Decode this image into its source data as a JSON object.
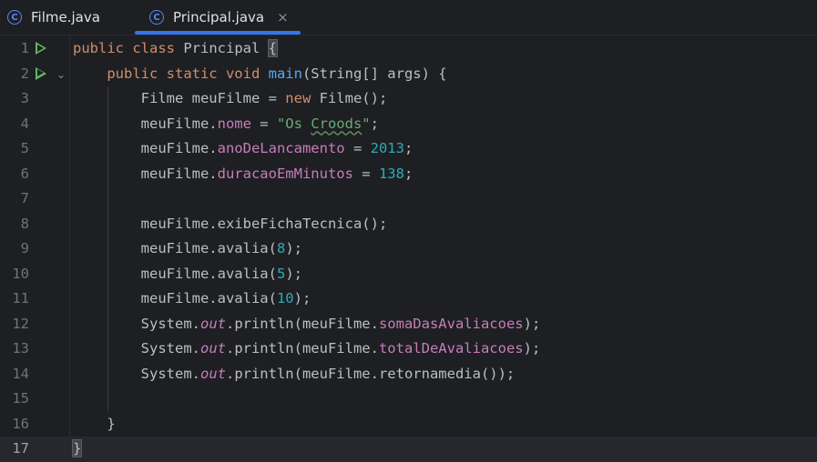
{
  "tabs": [
    {
      "icon": "C",
      "label": "Filme.java",
      "active": false
    },
    {
      "icon": "C",
      "label": "Principal.java",
      "active": true,
      "close": "×"
    }
  ],
  "colors": {
    "background": "#1e1f22",
    "keyword": "#cf8e6d",
    "method": "#56a8f5",
    "field": "#c77dbb",
    "number": "#2aacb8",
    "string": "#6aab73",
    "text": "#bcbec4",
    "active_tab_accent": "#3574f0",
    "run_icon": "#5fb865"
  },
  "gutter": {
    "run_icons": [
      "run-icon",
      "run-icon"
    ],
    "fold_icon": "chevron-down-icon"
  },
  "lines": [
    {
      "n": "1",
      "tokens": [
        [
          "kw",
          "public class "
        ],
        [
          "",
          "Principal "
        ],
        [
          "brace",
          "{"
        ]
      ]
    },
    {
      "n": "2",
      "tokens": [
        [
          "",
          "    "
        ],
        [
          "kw",
          "public static void "
        ],
        [
          "fn",
          "main"
        ],
        [
          "",
          "(String[] args) {"
        ]
      ]
    },
    {
      "n": "3",
      "tokens": [
        [
          "",
          "        Filme meuFilme = "
        ],
        [
          "kw",
          "new "
        ],
        [
          "",
          "Filme();"
        ]
      ]
    },
    {
      "n": "4",
      "tokens": [
        [
          "",
          "        meuFilme."
        ],
        [
          "fld",
          "nome"
        ],
        [
          "",
          " = "
        ],
        [
          "str",
          "\"Os "
        ],
        [
          "strtypo",
          "Croods"
        ],
        [
          "str",
          "\""
        ],
        [
          "",
          ";"
        ]
      ]
    },
    {
      "n": "5",
      "tokens": [
        [
          "",
          "        meuFilme."
        ],
        [
          "fld",
          "anoDeLancamento"
        ],
        [
          "",
          " = "
        ],
        [
          "num",
          "2013"
        ],
        [
          "",
          ";"
        ]
      ]
    },
    {
      "n": "6",
      "tokens": [
        [
          "",
          "        meuFilme."
        ],
        [
          "fld",
          "duracaoEmMinutos"
        ],
        [
          "",
          " = "
        ],
        [
          "num",
          "138"
        ],
        [
          "",
          ";"
        ]
      ]
    },
    {
      "n": "7",
      "tokens": []
    },
    {
      "n": "8",
      "tokens": [
        [
          "",
          "        meuFilme.exibeFichaTecnica();"
        ]
      ]
    },
    {
      "n": "9",
      "tokens": [
        [
          "",
          "        meuFilme.avalia("
        ],
        [
          "num",
          "8"
        ],
        [
          "",
          ");"
        ]
      ]
    },
    {
      "n": "10",
      "tokens": [
        [
          "",
          "        meuFilme.avalia("
        ],
        [
          "num",
          "5"
        ],
        [
          "",
          ");"
        ]
      ]
    },
    {
      "n": "11",
      "tokens": [
        [
          "",
          "        meuFilme.avalia("
        ],
        [
          "num",
          "10"
        ],
        [
          "",
          ");"
        ]
      ]
    },
    {
      "n": "12",
      "tokens": [
        [
          "",
          "        System."
        ],
        [
          "static",
          "out"
        ],
        [
          "",
          ".println(meuFilme."
        ],
        [
          "fld",
          "somaDasAvaliacoes"
        ],
        [
          "",
          ");"
        ]
      ]
    },
    {
      "n": "13",
      "tokens": [
        [
          "",
          "        System."
        ],
        [
          "static",
          "out"
        ],
        [
          "",
          ".println(meuFilme."
        ],
        [
          "fld",
          "totalDeAvaliacoes"
        ],
        [
          "",
          ");"
        ]
      ]
    },
    {
      "n": "14",
      "tokens": [
        [
          "",
          "        System."
        ],
        [
          "static",
          "out"
        ],
        [
          "",
          ".println(meuFilme.retornamedia());"
        ]
      ]
    },
    {
      "n": "15",
      "tokens": []
    },
    {
      "n": "16",
      "tokens": [
        [
          "",
          "    }"
        ]
      ]
    },
    {
      "n": "17",
      "tokens": [
        [
          "brace",
          "}"
        ]
      ],
      "current": true
    }
  ]
}
